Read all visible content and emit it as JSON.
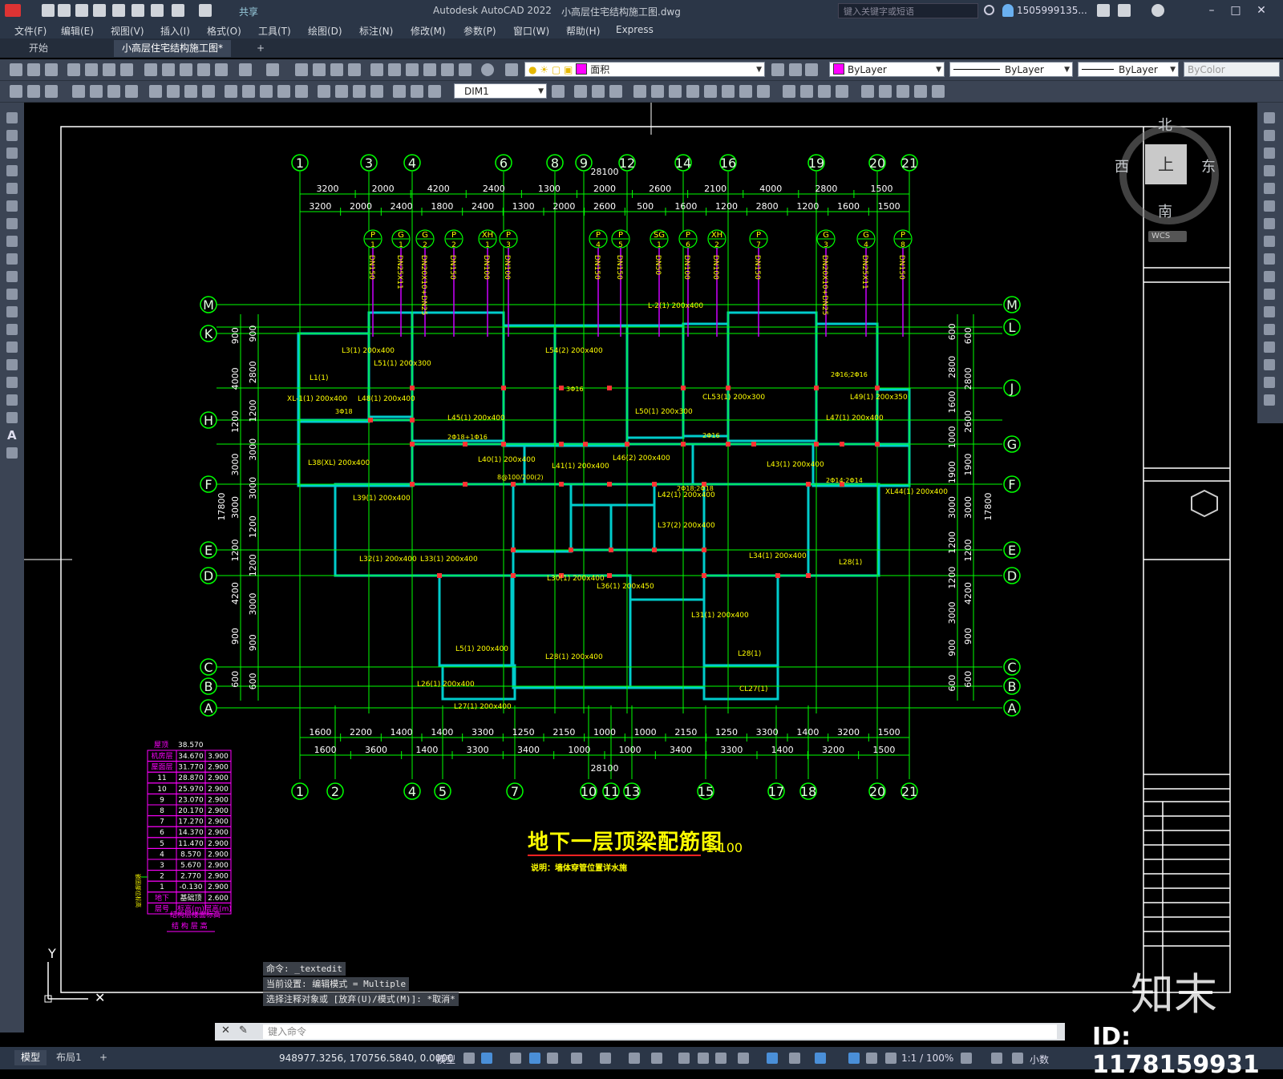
{
  "titlebar": {
    "share_label": "共享",
    "app_title": "Autodesk AutoCAD 2022",
    "doc_title": "小高层住宅结构施工图.dwg",
    "search_placeholder": "键入关键字或短语",
    "user": "1505999135..."
  },
  "menubar": {
    "items": [
      "文件(F)",
      "编辑(E)",
      "视图(V)",
      "插入(I)",
      "格式(O)",
      "工具(T)",
      "绘图(D)",
      "标注(N)",
      "修改(M)",
      "参数(P)",
      "窗口(W)",
      "帮助(H)",
      "Express"
    ]
  },
  "tabs": {
    "start": "开始",
    "active": "小高层住宅结构施工图*",
    "add": "+"
  },
  "toolbar1": {
    "layer_value": "面积",
    "color_value": "ByLayer",
    "linetype_value": "ByLayer",
    "lineweight_value": "ByLayer",
    "plotstyle_value": "ByColor"
  },
  "toolbar2": {
    "dimstyle_value": "DIM1"
  },
  "colors": {
    "grid_line": "#00ff00",
    "beam": "#00cccc",
    "text": "#ffff00",
    "pipe": "#cc00ff",
    "node": "#ff3333",
    "title": "#ffff00",
    "table": "#ff00ff"
  },
  "viewcube": {
    "north": "北",
    "south": "南",
    "west": "西",
    "east": "东",
    "top": "上",
    "wcs": "WCS"
  },
  "drawing": {
    "title": "地下一层顶梁配筋图",
    "scale": "1:100",
    "note": "说明：墙体穿管位置详水施",
    "axes_top": [
      "1",
      "3",
      "4",
      "6",
      "8",
      "9",
      "12",
      "14",
      "16",
      "19",
      "20",
      "21"
    ],
    "axes_bottom": [
      "1",
      "2",
      "4",
      "5",
      "7",
      "10",
      "11",
      "13",
      "15",
      "17",
      "18",
      "20",
      "21"
    ],
    "axes_left": [
      "M",
      "K",
      "H",
      "F",
      "E",
      "D",
      "C",
      "B",
      "A"
    ],
    "axes_right": [
      "M",
      "L",
      "J",
      "G",
      "F",
      "E",
      "D",
      "C",
      "B",
      "A"
    ],
    "dims_top_row1": [
      "3200",
      "2000",
      "4200",
      "2400",
      "1300",
      "2000",
      "2600",
      "2100",
      "4000",
      "2800",
      "1500"
    ],
    "dims_top_row2": [
      "3200",
      "2000",
      "2400",
      "1800",
      "2400",
      "1300",
      "2000",
      "2600",
      "500",
      "1600",
      "1200",
      "2800",
      "1200",
      "1600",
      "1500"
    ],
    "dim_top_total": "28100",
    "dims_bottom_row1": [
      "1600",
      "2200",
      "1400",
      "1400",
      "3300",
      "1250",
      "2150",
      "1000",
      "1000",
      "2150",
      "1250",
      "3300",
      "1400",
      "3200",
      "1500"
    ],
    "dims_bottom_row2": [
      "1600",
      "3600",
      "1400",
      "3300",
      "3400",
      "1000",
      "1000",
      "3400",
      "3300",
      "1400",
      "3200",
      "1500"
    ],
    "dim_bottom_total": "28100",
    "dims_left_outer": [
      "900",
      "4000",
      "1200",
      "3000",
      "3000",
      "1200",
      "4200",
      "900",
      "600"
    ],
    "dims_left_inner": [
      "900",
      "2800",
      "1200",
      "3000",
      "3000",
      "1200",
      "1200",
      "3000",
      "900",
      "600"
    ],
    "dim_left_total": "17800",
    "dims_right_inner": [
      "600",
      "2800",
      "1600",
      "1000",
      "1900",
      "3000",
      "1200",
      "1200",
      "3000",
      "900",
      "600"
    ],
    "dims_right_outer": [
      "600",
      "2800",
      "2600",
      "1900",
      "3000",
      "1200",
      "4200",
      "900",
      "600"
    ],
    "dim_right_total": "17800",
    "pipes": [
      {
        "tag": "P",
        "num": "1",
        "size": "DN150"
      },
      {
        "tag": "G",
        "num": "1",
        "size": "DN25X11"
      },
      {
        "tag": "G",
        "num": "2",
        "size": "DN20X10+DN25"
      },
      {
        "tag": "P",
        "num": "2",
        "size": "DN150"
      },
      {
        "tag": "XH",
        "num": "1",
        "size": "DN100"
      },
      {
        "tag": "P",
        "num": "3",
        "size": "DN100"
      },
      {
        "tag": "P",
        "num": "4",
        "size": "DN150"
      },
      {
        "tag": "P",
        "num": "5",
        "size": "DN150"
      },
      {
        "tag": "SG",
        "num": "1",
        "size": "DN50"
      },
      {
        "tag": "P",
        "num": "6",
        "size": "DN100"
      },
      {
        "tag": "XH",
        "num": "2",
        "size": "DN100"
      },
      {
        "tag": "P",
        "num": "7",
        "size": "DN150"
      },
      {
        "tag": "G",
        "num": "3",
        "size": "DN20X10+DN25"
      },
      {
        "tag": "G",
        "num": "4",
        "size": "DN25X11"
      },
      {
        "tag": "P",
        "num": "8",
        "size": "DN150"
      }
    ],
    "beam_labels": [
      "L1(1)",
      "L3(1) 200x400",
      "L51(1) 200x300",
      "L54(2) 200x400",
      "L-2(1) 200x400",
      "XL-1(1) 200x400",
      "L48(1) 200x400",
      "L45(1) 200x400",
      "L50(1) 200x300",
      "CL53(1) 200x300",
      "L49(1) 200x350",
      "L47(1) 200x400",
      "L38(XL) 200x400",
      "L40(1) 200x400",
      "L41(1) 200x400",
      "L46(2) 200x400",
      "L43(1) 200x400",
      "L39(1) 200x400",
      "L42(1) 200x400",
      "L37(2) 200x400",
      "XL44(1) 200x400",
      "L32(1) 200x400",
      "L33(1) 200x400",
      "L34(1) 200x400",
      "L28(1)",
      "L30(1) 200x400",
      "L36(1) 200x450",
      "L31(1) 200x400",
      "L5(1) 200x400",
      "L28(1) 200x400",
      "L28(1)",
      "L27(1) 200x400",
      "CL27(1)",
      "L26(1) 200x400"
    ],
    "reinf_labels": [
      "2Φ18+1Φ16",
      "3Φ18",
      "3Φ16",
      "2Φ16",
      "2Φ14;2Φ14",
      "8@100/200(2)",
      "2Φ16;2Φ16",
      "2Φ18;2Φ18"
    ]
  },
  "floor_table": {
    "header": [
      "屋顶",
      "38.570"
    ],
    "rows": [
      [
        "机房层",
        "34.670",
        "3.900"
      ],
      [
        "屋面层",
        "31.770",
        "2.900"
      ],
      [
        "11",
        "28.870",
        "2.900"
      ],
      [
        "10",
        "25.970",
        "2.900"
      ],
      [
        "9",
        "23.070",
        "2.900"
      ],
      [
        "8",
        "20.170",
        "2.900"
      ],
      [
        "7",
        "17.270",
        "2.900"
      ],
      [
        "6",
        "14.370",
        "2.900"
      ],
      [
        "5",
        "11.470",
        "2.900"
      ],
      [
        "4",
        "8.570",
        "2.900"
      ],
      [
        "3",
        "5.670",
        "2.900"
      ],
      [
        "2",
        "2.770",
        "2.900"
      ],
      [
        "1",
        "-0.130",
        "2.900"
      ],
      [
        "地下",
        "基础顶",
        "2.600"
      ],
      [
        "层号",
        "标高(m)",
        "层高(m)"
      ]
    ],
    "side_label": "嵌固部位标高",
    "caption1": "结构层楼面标高",
    "caption2": "结 构 层 高"
  },
  "ucs": {
    "y": "Y"
  },
  "command": {
    "history": [
      "命令: _textedit",
      "当前设置: 编辑模式 = Multiple",
      "选择注释对象或 [放弃(U)/模式(M)]: *取消*"
    ],
    "placeholder": "键入命令"
  },
  "statusbar": {
    "tab_model": "模型",
    "tab_layout": "布局1",
    "add": "+",
    "coords": "948977.3256, 170756.5840, 0.0000",
    "mode": "模型",
    "scale": "1:1 / 100%",
    "units": "小数"
  },
  "watermark": {
    "brand": "知末",
    "id": "ID: 1178159931"
  }
}
